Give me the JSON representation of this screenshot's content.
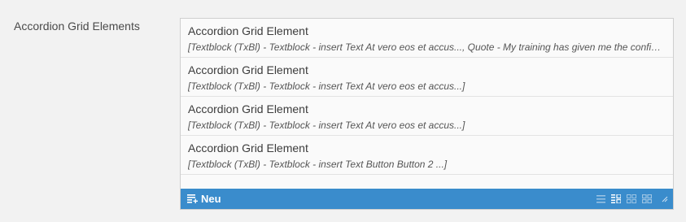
{
  "field": {
    "label": "Accordion Grid Elements"
  },
  "items": [
    {
      "title": "Accordion Grid Element",
      "description": "[Textblock (TxBl) - Textblock - insert Text At vero eos et accus..., Quote - My training has given me the confidence to ...]"
    },
    {
      "title": "Accordion Grid Element",
      "description": "[Textblock (TxBl) - Textblock - insert Text At vero eos et accus...]"
    },
    {
      "title": "Accordion Grid Element",
      "description": "[Textblock (TxBl) - Textblock - insert Text At vero eos et accus...]"
    },
    {
      "title": "Accordion Grid Element",
      "description": "[Textblock (TxBl) - Textblock - insert Text Button Button 2 ...]"
    }
  ],
  "footer": {
    "new_label": "Neu",
    "background": "#3a8ccc",
    "icons": [
      "list-view-icon",
      "grid-list-view-icon",
      "small-grid-view-icon",
      "large-grid-view-icon",
      "resize-handle-icon"
    ]
  }
}
